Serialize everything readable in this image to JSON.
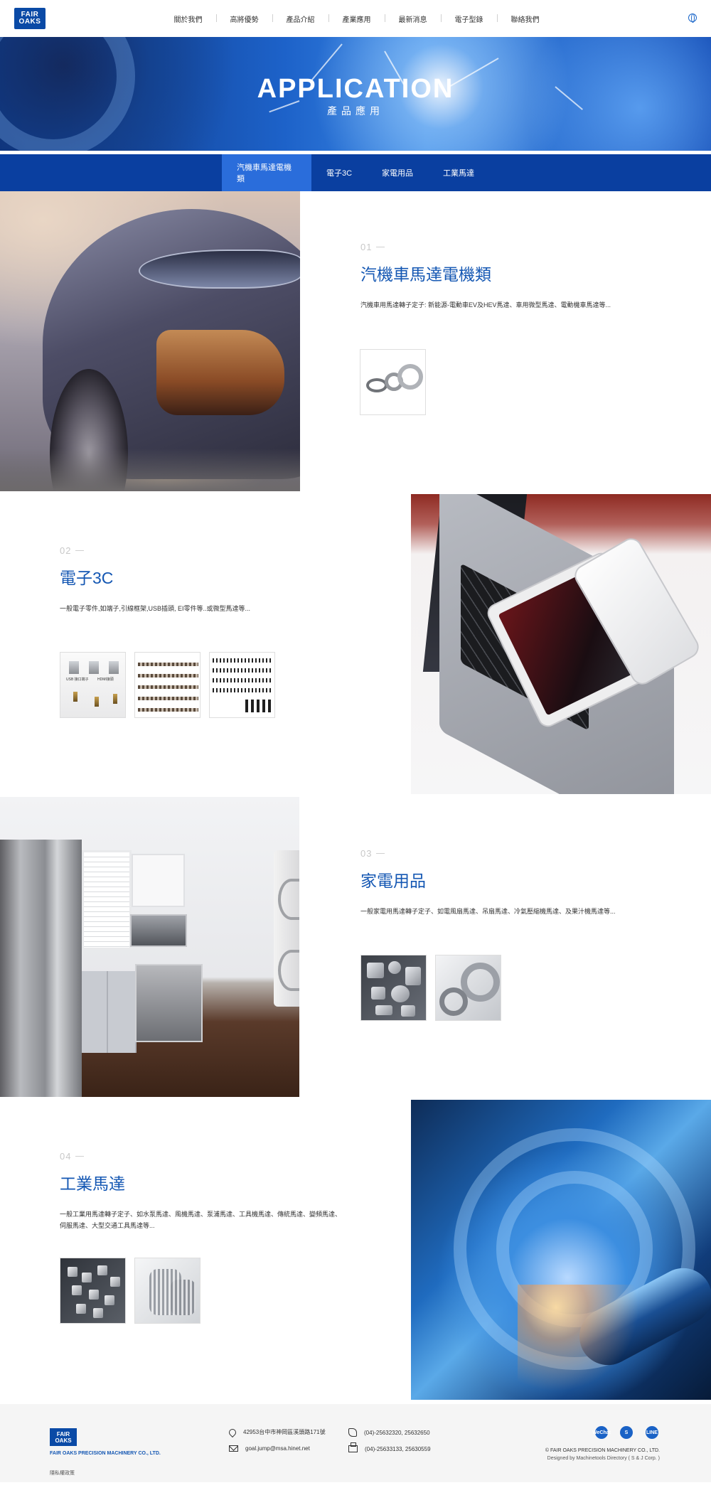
{
  "header": {
    "logo": {
      "line1": "FAIR",
      "line2": "OAKS"
    },
    "nav": [
      "關於我們",
      "高將優勢",
      "產品介紹",
      "產業應用",
      "最新消息",
      "電子型錄",
      "聯絡我們"
    ],
    "language_icon": "globe-icon"
  },
  "banner": {
    "title": "APPLICATION",
    "subtitle": "產品應用"
  },
  "tabs": [
    {
      "label": "汽機車馬達電機類",
      "active": true
    },
    {
      "label": "電子3C",
      "active": false
    },
    {
      "label": "家電用品",
      "active": false
    },
    {
      "label": "工業馬達",
      "active": false
    }
  ],
  "sections": [
    {
      "number": "01",
      "title": "汽機車馬達電機類",
      "description": "汽機車用馬達轉子定子: 新能源-電動車EV及HEV馬達、車用微型馬達、電動機車馬達等...",
      "photo": "sports-car-headlight"
    },
    {
      "number": "02",
      "title": "電子3C",
      "description": "一般電子零件,如端子,引線框架,USB插頭, EI零件等..或微型馬達等...",
      "photo": "laptop-tablet-phone"
    },
    {
      "number": "03",
      "title": "家電用品",
      "description": "一般家電用馬達轉子定子、如電風扇馬達、吊扇馬達、冷氣壓縮機馬達、及果汁機馬達等...",
      "photo": "kitchen-appliances"
    },
    {
      "number": "04",
      "title": "工業馬達",
      "description_line1": "一般工業用馬達轉子定子、如水泵馬達、風機馬達、泵浦馬達、工具機馬達、傳統馬達、變頻馬達、",
      "description_line2": "伺服馬達、大型交通工具馬達等...",
      "photo": "industrial-machining-sparks"
    }
  ],
  "thumb_labels": {
    "e1_left": "USB 接口端子",
    "e1_right": "HDMI接頭"
  },
  "footer": {
    "logo": {
      "line1": "FAIR",
      "line2": "OAKS"
    },
    "company": "FAIR OAKS PRECISION MACHINERY CO., LTD.",
    "privacy": "隱私權政策",
    "address": "42953台中市神岡區溪頭路171號",
    "email": "goal.jump@msa.hinet.net",
    "phone": "(04)-25632320, 25632650",
    "fax": "(04)-25633133, 25630559",
    "social": [
      "wechat-icon",
      "skype-icon",
      "line-icon"
    ],
    "social_labels": {
      "wechat": "WeChat",
      "skype": "S",
      "line": "LINE"
    },
    "copyright": "© FAIR OAKS PRECISION MACHINERY CO., LTD.",
    "designed_by": "Designed by Machinetools Directory ( S & J Corp. )"
  },
  "colors": {
    "brand_blue": "#0a4aa6",
    "tab_bar": "#0a3fa0",
    "tab_active": "#2a6ddb",
    "title_blue": "#1457b3"
  }
}
